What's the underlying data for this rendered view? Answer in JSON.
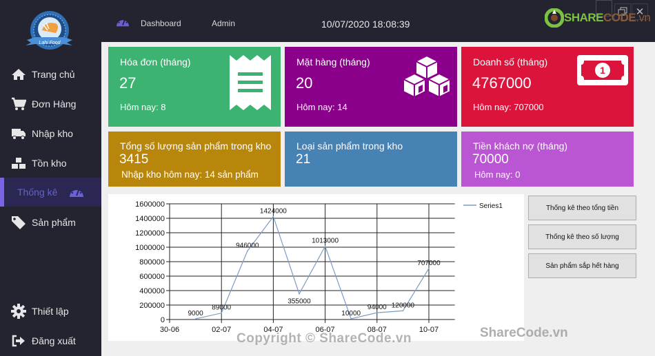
{
  "sidebar": {
    "logo_text": "Lahi Food",
    "items": [
      {
        "label": "Trang chủ",
        "icon": "home-icon"
      },
      {
        "label": "Đơn Hàng",
        "icon": "cart-icon"
      },
      {
        "label": "Nhập kho",
        "icon": "truck-icon"
      },
      {
        "label": "Tồn kho",
        "icon": "boxes-icon"
      },
      {
        "label": "Thống kê",
        "icon": "gauge-icon",
        "active": true
      },
      {
        "label": "Sản phẩm",
        "icon": "tag-icon"
      }
    ],
    "bottom_items": [
      {
        "label": "Thiết lập",
        "icon": "gear-icon"
      },
      {
        "label": "Đăng xuất",
        "icon": "sign-out-icon"
      }
    ]
  },
  "header": {
    "section": "Dashboard",
    "user": "Admin",
    "datetime": "10/07/2020 18:08:39",
    "watermark_brand_a": "SHARE",
    "watermark_brand_b": "CODE",
    "watermark_brand_c": ".vn"
  },
  "cards": [
    {
      "title": "Hóa đơn (tháng)",
      "value": "27",
      "sub": "Hôm nay: 8",
      "color": "#3cb371",
      "icon": "receipt-icon"
    },
    {
      "title": "Mặt hàng (tháng)",
      "value": "20",
      "sub": "Hôm nay: 14",
      "color": "#8b008b",
      "icon": "cubes-icon"
    },
    {
      "title": "Doanh số (tháng)",
      "value": "4767000",
      "sub": "Hôm nay: 707000",
      "color": "#dc143c",
      "icon": "money-bill-icon"
    },
    {
      "title": "Tổng số lượng sản phẩm trong kho",
      "value": "3415",
      "sub": "Nhập kho hôm nay: 14 sản phẩm",
      "color": "#b8860b"
    },
    {
      "title": "Loại sản phẩm trong kho",
      "value": "21",
      "sub": "",
      "color": "#4682b4"
    },
    {
      "title": "Tiền khách nợ (tháng)",
      "value": "70000",
      "sub": "Hôm nay: 0",
      "color": "#ba55d3"
    }
  ],
  "buttons": [
    {
      "label": "Thống kê theo tổng tiền"
    },
    {
      "label": "Thống kê theo số lượng"
    },
    {
      "label": "Sản phẩm sắp hết hàng"
    }
  ],
  "watermarks": {
    "copyright": "Copyright © ShareCode.vn",
    "sharecode": "ShareCode.vn"
  },
  "chart_data": {
    "type": "line",
    "title": "",
    "xlabel": "",
    "ylabel": "",
    "x_tick_labels": [
      "30-06",
      "02-07",
      "04-07",
      "06-07",
      "08-07",
      "10-07"
    ],
    "x_range_days": [
      0,
      11
    ],
    "ylim": [
      0,
      1600000
    ],
    "y_ticks": [
      0,
      200000,
      400000,
      600000,
      800000,
      1000000,
      1200000,
      1400000,
      1600000
    ],
    "grid": true,
    "legend": "top-right",
    "series": [
      {
        "name": "Series1",
        "color": "#7a9cc6",
        "x": [
          "01-07",
          "02-07",
          "03-07",
          "04-07",
          "05-07",
          "06-07",
          "07-07",
          "08-07",
          "09-07",
          "10-07"
        ],
        "x_days": [
          1,
          2,
          3,
          4,
          5,
          6,
          7,
          8,
          9,
          10
        ],
        "values": [
          9000,
          89000,
          946000,
          1424000,
          355000,
          1013000,
          10000,
          94000,
          120000,
          707000
        ]
      }
    ]
  }
}
